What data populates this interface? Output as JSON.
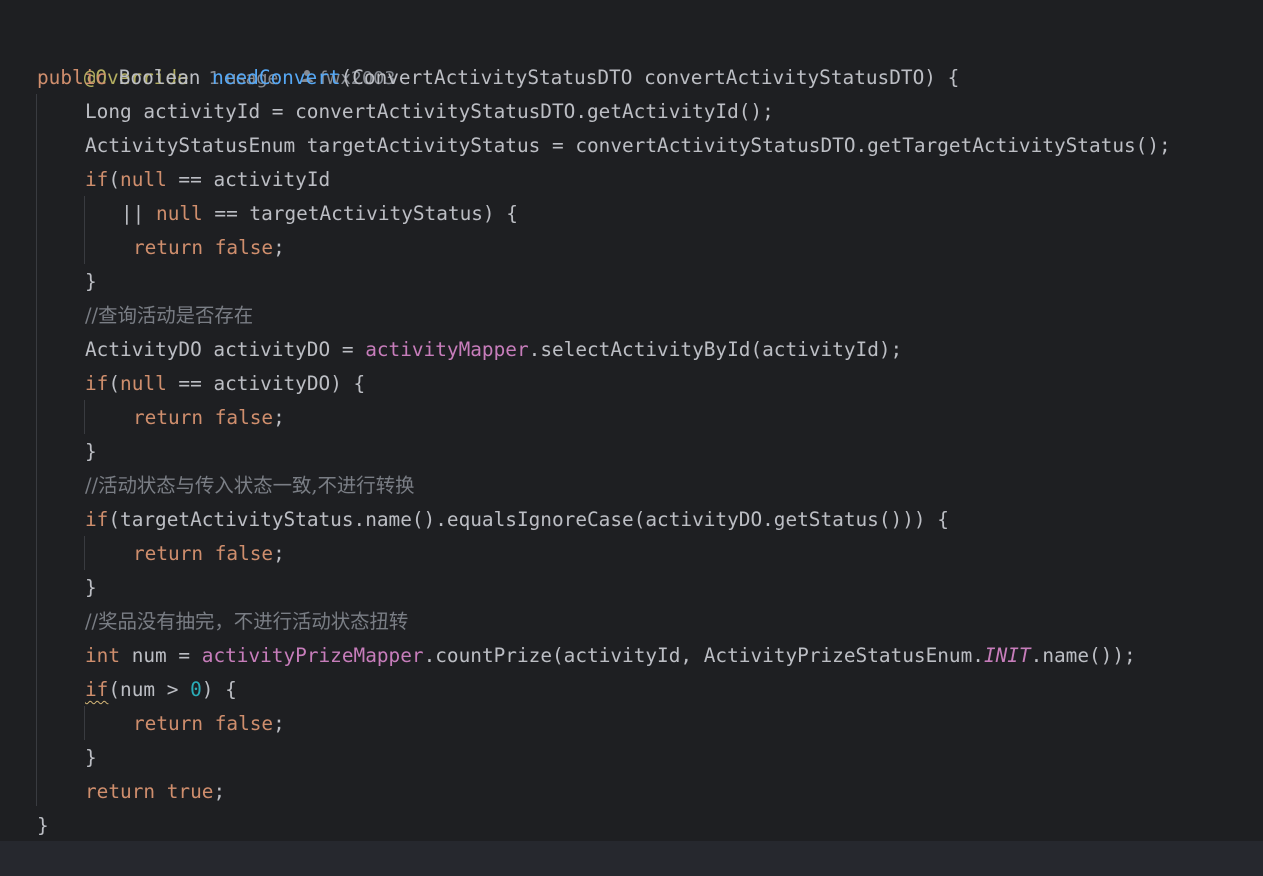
{
  "header": {
    "annotation": "@Override",
    "usages": "1 usage",
    "author": "fwx2003",
    "author_icon": "user-icon"
  },
  "code": {
    "sig_public": "public",
    "sig_type": " Boolean ",
    "sig_method": "needConvert",
    "sig_params": "(ConvertActivityStatusDTO convertActivityStatusDTO) {",
    "l3": "Long activityId = convertActivityStatusDTO.getActivityId();",
    "l4": "ActivityStatusEnum targetActivityStatus = convertActivityStatusDTO.getTargetActivityStatus();",
    "kw_if": "if",
    "kw_null": "null",
    "kw_return": "return",
    "kw_false": "false",
    "kw_true": "true",
    "kw_int": "int",
    "l5_rest": " == activityId",
    "l6_or": "|| ",
    "l6_rest": " == targetActivityStatus) {",
    "brace_close": "}",
    "semicolon": ";",
    "paren_open": "(",
    "comment1": "//查询活动是否存在",
    "l10_a": "ActivityDO activityDO = ",
    "l10_field": "activityMapper",
    "l10_b": ".selectActivityById(activityId);",
    "l11_rest": " == activityDO) {",
    "comment2": "//活动状态与传入状态一致,不进行转换",
    "l15_rest": "(targetActivityStatus.name().equalsIgnoreCase(activityDO.getStatus())) {",
    "comment3": "//奖品没有抽完，不进行活动状态扭转",
    "l19_a": " num = ",
    "l19_field": "activityPrizeMapper",
    "l19_b": ".countPrize(activityId, ActivityPrizeStatusEnum.",
    "l19_const": "INIT",
    "l19_c": ".name());",
    "l20_a": "(num > ",
    "l20_num": "0",
    "l20_b": ") {"
  },
  "colors": {
    "background": "#1e1f22",
    "keyword": "#cf8e6d",
    "annotation": "#b3ae60",
    "method_declaration": "#56a8f5",
    "field": "#c77dbb",
    "number": "#2aacb8",
    "comment": "#7a7e85",
    "text": "#bcbec4"
  }
}
